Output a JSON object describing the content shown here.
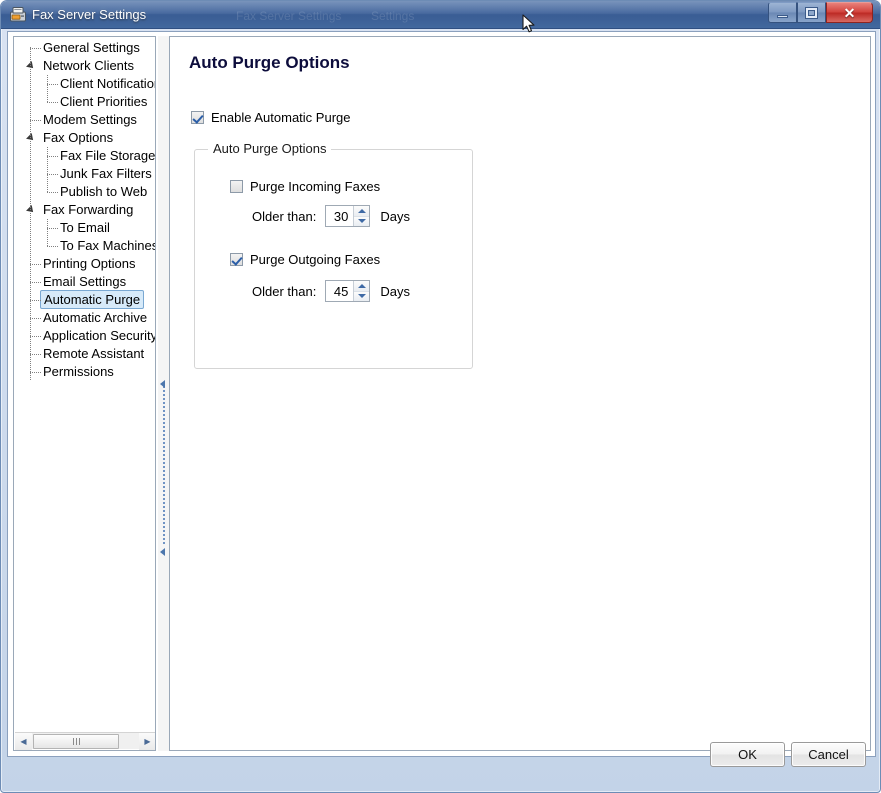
{
  "window": {
    "title": "Fax Server Settings",
    "icon": "fax-machine-icon",
    "ghost_labels": [
      "Fax Server Settings",
      "Settings"
    ],
    "controls": {
      "minimize": "Minimize",
      "maximize": "Restore",
      "close": "Close",
      "close_glyph": "✕"
    },
    "accent_title_bg": "#3f639b",
    "accent_close": "#d2453f"
  },
  "sidebar": {
    "items": [
      {
        "label": "General Settings",
        "level": 1,
        "expander": false,
        "selected": false
      },
      {
        "label": "Network Clients",
        "level": 1,
        "expander": true,
        "selected": false
      },
      {
        "label": "Client Notification",
        "level": 2,
        "expander": false,
        "selected": false
      },
      {
        "label": "Client Priorities",
        "level": 2,
        "expander": false,
        "selected": false
      },
      {
        "label": "Modem Settings",
        "level": 1,
        "expander": false,
        "selected": false
      },
      {
        "label": "Fax Options",
        "level": 1,
        "expander": true,
        "selected": false
      },
      {
        "label": "Fax File Storage",
        "level": 2,
        "expander": false,
        "selected": false
      },
      {
        "label": "Junk Fax Filters",
        "level": 2,
        "expander": false,
        "selected": false
      },
      {
        "label": "Publish to Web",
        "level": 2,
        "expander": false,
        "selected": false
      },
      {
        "label": "Fax Forwarding",
        "level": 1,
        "expander": true,
        "selected": false
      },
      {
        "label": "To Email",
        "level": 2,
        "expander": false,
        "selected": false
      },
      {
        "label": "To Fax Machines",
        "level": 2,
        "expander": false,
        "selected": false
      },
      {
        "label": "Printing Options",
        "level": 1,
        "expander": false,
        "selected": false
      },
      {
        "label": "Email Settings",
        "level": 1,
        "expander": false,
        "selected": false
      },
      {
        "label": "Automatic Purge",
        "level": 1,
        "expander": false,
        "selected": true
      },
      {
        "label": "Automatic Archive",
        "level": 1,
        "expander": false,
        "selected": false
      },
      {
        "label": "Application Security",
        "level": 1,
        "expander": false,
        "selected": false
      },
      {
        "label": "Remote Assistant",
        "level": 1,
        "expander": false,
        "selected": false
      },
      {
        "label": "Permissions",
        "level": 1,
        "expander": false,
        "selected": false
      }
    ],
    "hscroll": {
      "left_arrow": "◀",
      "right_arrow": "▶"
    },
    "selected_bg": "#d7eaf9",
    "selected_border": "#7aa8d2"
  },
  "content": {
    "title": "Auto Purge Options",
    "enable_purge": {
      "label": "Enable Automatic Purge",
      "checked": true
    },
    "groupbox": {
      "legend": "Auto Purge Options",
      "options": [
        {
          "label": "Purge Incoming Faxes",
          "checked": false,
          "older_than_label": "Older than:",
          "value": "30",
          "units": "Days"
        },
        {
          "label": "Purge Outgoing Faxes",
          "checked": true,
          "older_than_label": "Older than:",
          "value": "45",
          "units": "Days"
        }
      ]
    }
  },
  "footer": {
    "ok": "OK",
    "cancel": "Cancel"
  }
}
